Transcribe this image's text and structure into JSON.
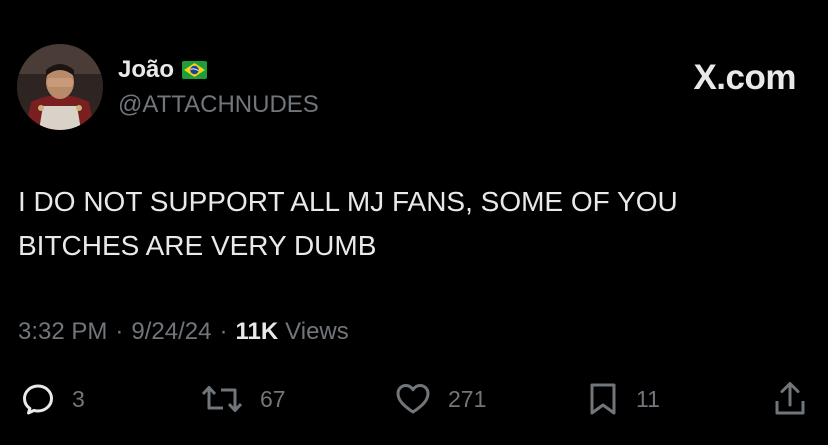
{
  "tweet": {
    "author": {
      "name": "João",
      "flag_icon": "brazil-flag-icon",
      "handle": "@ATTACHNUDES"
    },
    "brand": "X.com",
    "text": "I DO NOT SUPPORT ALL MJ FANS, SOME OF YOU\nBITCHES ARE VERY DUMB",
    "meta": {
      "time": "3:32 PM",
      "separator": "·",
      "date": "9/24/24",
      "views_count": "11K",
      "views_label": "Views"
    },
    "actions": {
      "replies": {
        "icon": "reply-icon",
        "count": "3"
      },
      "reposts": {
        "icon": "repost-icon",
        "count": "67"
      },
      "likes": {
        "icon": "like-icon",
        "count": "271"
      },
      "bookmarks": {
        "icon": "bookmark-icon",
        "count": "11"
      },
      "share": {
        "icon": "share-icon"
      }
    }
  },
  "colors": {
    "background": "#000000",
    "primary_text": "#e7e9ea",
    "secondary_text": "#71767b"
  }
}
